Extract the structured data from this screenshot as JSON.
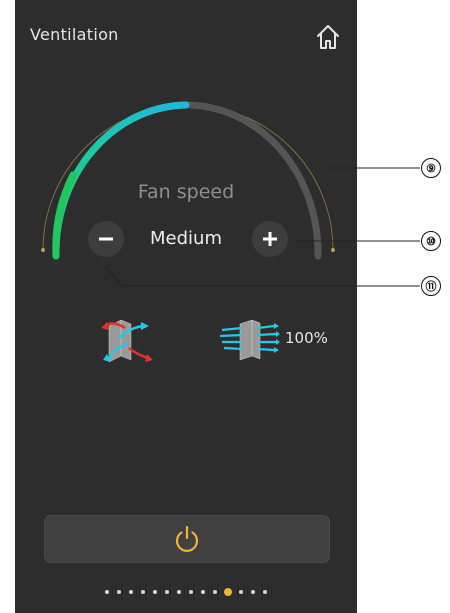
{
  "header": {
    "title": "Ventilation",
    "home_icon": "home-icon"
  },
  "fan": {
    "label": "Fan speed",
    "value": "Medium",
    "level_fraction": 0.5,
    "colors": {
      "low": "#22c55e",
      "mid": "#1ec9a8",
      "high": "#1fb8e0",
      "track": "#555555",
      "outline": "#b8a25a"
    }
  },
  "controls": {
    "minus_icon": "minus-icon",
    "plus_icon": "plus-icon",
    "power_icon": "power-icon",
    "power_color": "#f2b233"
  },
  "status": {
    "heat_recovery_icon": "heat-recovery-icon",
    "filter_icon": "filter-icon",
    "filter_value": "100%"
  },
  "pager": {
    "count": 14,
    "active_index": 10
  },
  "callouts": [
    "⑨",
    "⑩",
    "⑪"
  ]
}
